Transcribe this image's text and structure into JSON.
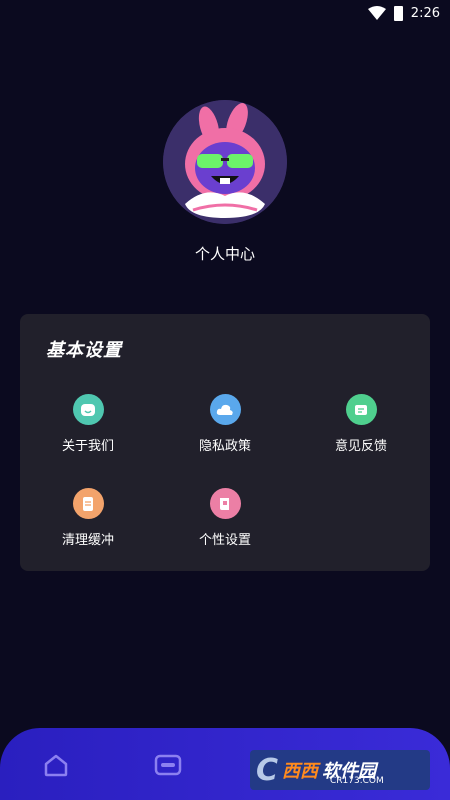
{
  "status_bar": {
    "time": "2:26"
  },
  "profile": {
    "title": "个人中心",
    "avatar_icon": "avatar-image"
  },
  "settings": {
    "title": "基本设置",
    "items": [
      {
        "label": "关于我们",
        "icon": "smile-icon",
        "color": "#4fc7b0"
      },
      {
        "label": "隐私政策",
        "icon": "cloud-icon",
        "color": "#5aa8ec"
      },
      {
        "label": "意见反馈",
        "icon": "message-icon",
        "color": "#4fcf8e"
      },
      {
        "label": "清理缓冲",
        "icon": "document-icon",
        "color": "#f3a36b"
      },
      {
        "label": "个性设置",
        "icon": "book-icon",
        "color": "#ec7fa5"
      }
    ]
  },
  "tab_bar": {
    "tabs": [
      {
        "icon": "home-icon"
      },
      {
        "icon": "toggle-icon"
      },
      {
        "icon": "profile-icon"
      }
    ]
  },
  "watermark": {
    "main": "西西",
    "sub": "软件园",
    "url": "CR173.COM"
  },
  "colors": {
    "background": "#0b0a1f",
    "card": "#21202b",
    "tab_bar": "#2e22c9"
  }
}
